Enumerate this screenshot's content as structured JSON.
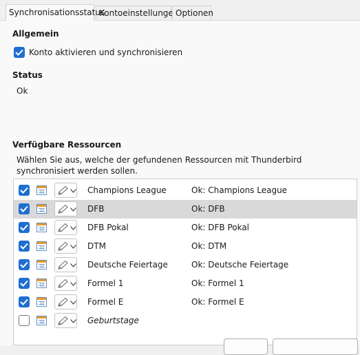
{
  "tabs": [
    {
      "label": "Synchronisationsstatus",
      "active": true
    },
    {
      "label": "Kontoeinstellungen",
      "active": false
    },
    {
      "label": "Optionen",
      "active": false
    }
  ],
  "general": {
    "title": "Allgemein",
    "activate_checkbox": {
      "label": "Konto aktivieren und synchronisieren",
      "checked": true
    }
  },
  "status": {
    "title": "Status",
    "value": "Ok"
  },
  "resources": {
    "title": "Verfügbare Ressourcen",
    "description": "Wählen Sie aus, welche der gefundenen Ressourcen mit Thunderbird synchronisiert werden sollen.",
    "items": [
      {
        "name": "Champions League",
        "status": "Ok: Champions League",
        "checked": true,
        "selected": false,
        "italic": false,
        "icon": "calendar-icon"
      },
      {
        "name": "DFB",
        "status": "Ok: DFB",
        "checked": true,
        "selected": true,
        "italic": false,
        "icon": "calendar-icon"
      },
      {
        "name": "DFB Pokal",
        "status": "Ok: DFB Pokal",
        "checked": true,
        "selected": false,
        "italic": false,
        "icon": "calendar-icon"
      },
      {
        "name": "DTM",
        "status": "Ok: DTM",
        "checked": true,
        "selected": false,
        "italic": false,
        "icon": "calendar-icon"
      },
      {
        "name": "Deutsche Feiertage",
        "status": "Ok: Deutsche Feiertage",
        "checked": true,
        "selected": false,
        "italic": false,
        "icon": "calendar-icon"
      },
      {
        "name": "Formel 1",
        "status": "Ok: Formel 1",
        "checked": true,
        "selected": false,
        "italic": false,
        "icon": "calendar-icon"
      },
      {
        "name": "Formel E",
        "status": "Ok: Formel E",
        "checked": true,
        "selected": false,
        "italic": false,
        "icon": "calendar-icon"
      },
      {
        "name": "Geburtstage",
        "status": "",
        "checked": false,
        "selected": false,
        "italic": true,
        "icon": "calendar-icon"
      }
    ]
  },
  "colors": {
    "accent": "#1f6fd1",
    "selected_row": "#d9d9d9",
    "panel_bg": "#f9f9f9"
  }
}
